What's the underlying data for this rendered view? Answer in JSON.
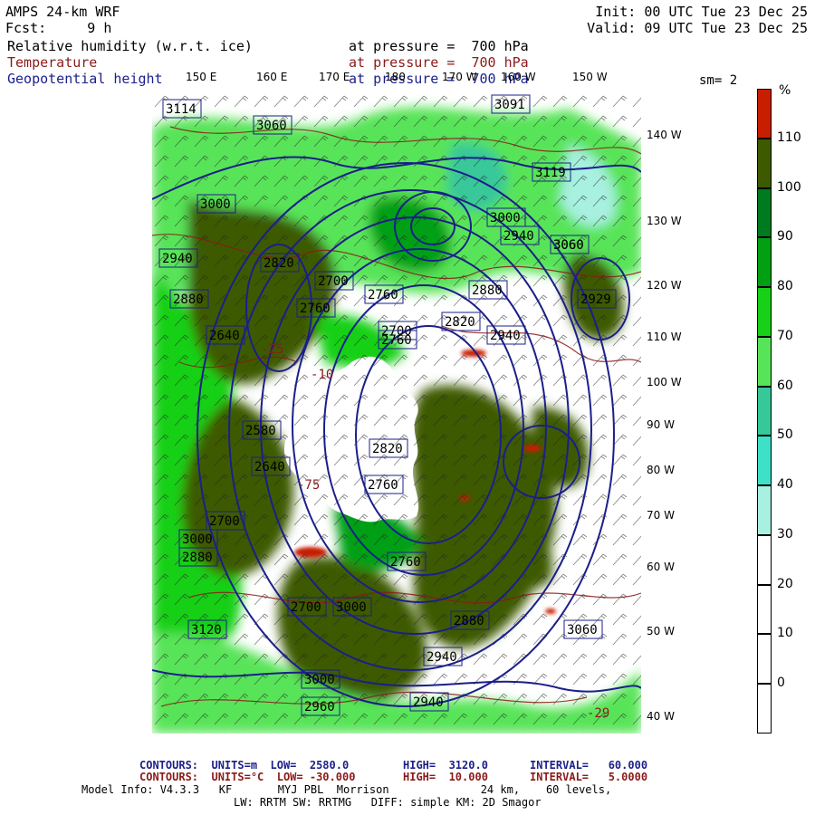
{
  "header": {
    "model": "AMPS 24-km WRF",
    "forecast": "Fcst:     9 h",
    "init": "Init: 00 UTC Tue 23 Dec 25",
    "valid": "Valid: 09 UTC Tue 23 Dec 25",
    "fields": [
      {
        "label": "Relative humidity (w.r.t. ice)",
        "level": "at pressure =  700 hPa",
        "color": "#000000"
      },
      {
        "label": "Temperature",
        "level": "at pressure =  700 hPa",
        "color": "#8b1a1a"
      },
      {
        "label": "Geopotential height",
        "level": "at pressure =  700 hPa",
        "color": "#1b1f8a"
      }
    ],
    "smoothing": "sm= 2"
  },
  "map": {
    "lon_labels": [
      "150 E",
      "160 E",
      "170 E",
      "180",
      "170 W",
      "160 W",
      "150 W"
    ],
    "lat_labels": [
      "140 W",
      "130 W",
      "120 W",
      "110 W",
      "100 W",
      "90 W",
      "80 W",
      "70 W",
      "60 W",
      "50 W",
      "40 W"
    ],
    "height_labels": [
      "3114",
      "3060",
      "3000",
      "2940",
      "2880",
      "2820",
      "2760",
      "2700",
      "2640",
      "2580",
      "3119",
      "2929",
      "3120",
      "3060",
      "3000",
      "2940",
      "2880",
      "2820",
      "2760",
      "2700",
      "2640",
      "2700",
      "2760",
      "2820",
      "2880",
      "2940",
      "3000",
      "3060",
      "3091",
      "2760",
      "2880",
      "2940",
      "3000",
      "2760",
      "2700",
      "3000",
      "2940",
      "3060",
      "2960"
    ],
    "temp_labels": [
      "-10",
      "-25",
      "-75",
      "-29"
    ],
    "colors": {
      "land_white": "#ffffff",
      "height_contour": "#1b1f8a",
      "temp_contour": "#8b1a1a",
      "barb": "#000000"
    }
  },
  "colorbar": {
    "unit": "%",
    "ticks": [
      "110",
      "100",
      "90",
      "80",
      "70",
      "60",
      "50",
      "40",
      "30",
      "20",
      "10",
      "0"
    ],
    "colors": [
      "#c81e00",
      "#3e5a00",
      "#007a1e",
      "#00a012",
      "#18d018",
      "#58e458",
      "#37c89a",
      "#3fe0c8",
      "#a8f0e0",
      "#ffffff",
      "#ffffff",
      "#ffffff",
      "#ffffff"
    ]
  },
  "footer": {
    "line1_label": "CONTOURS:  UNITS=m  LOW=  2580.0",
    "line1_high": "HIGH=  3120.0",
    "line1_int": "INTERVAL=   60.000",
    "line2_label": "CONTOURS:  UNITS=°C  LOW= -30.000",
    "line2_high": "HIGH=  10.000",
    "line2_int": "INTERVAL=   5.0000",
    "line3": "Model Info: V4.3.3   KF       MYJ PBL  Morrison              24 km,    60 levels,",
    "line4": "LW: RRTM SW: RRTMG   DIFF: simple KM: 2D Smagor"
  }
}
